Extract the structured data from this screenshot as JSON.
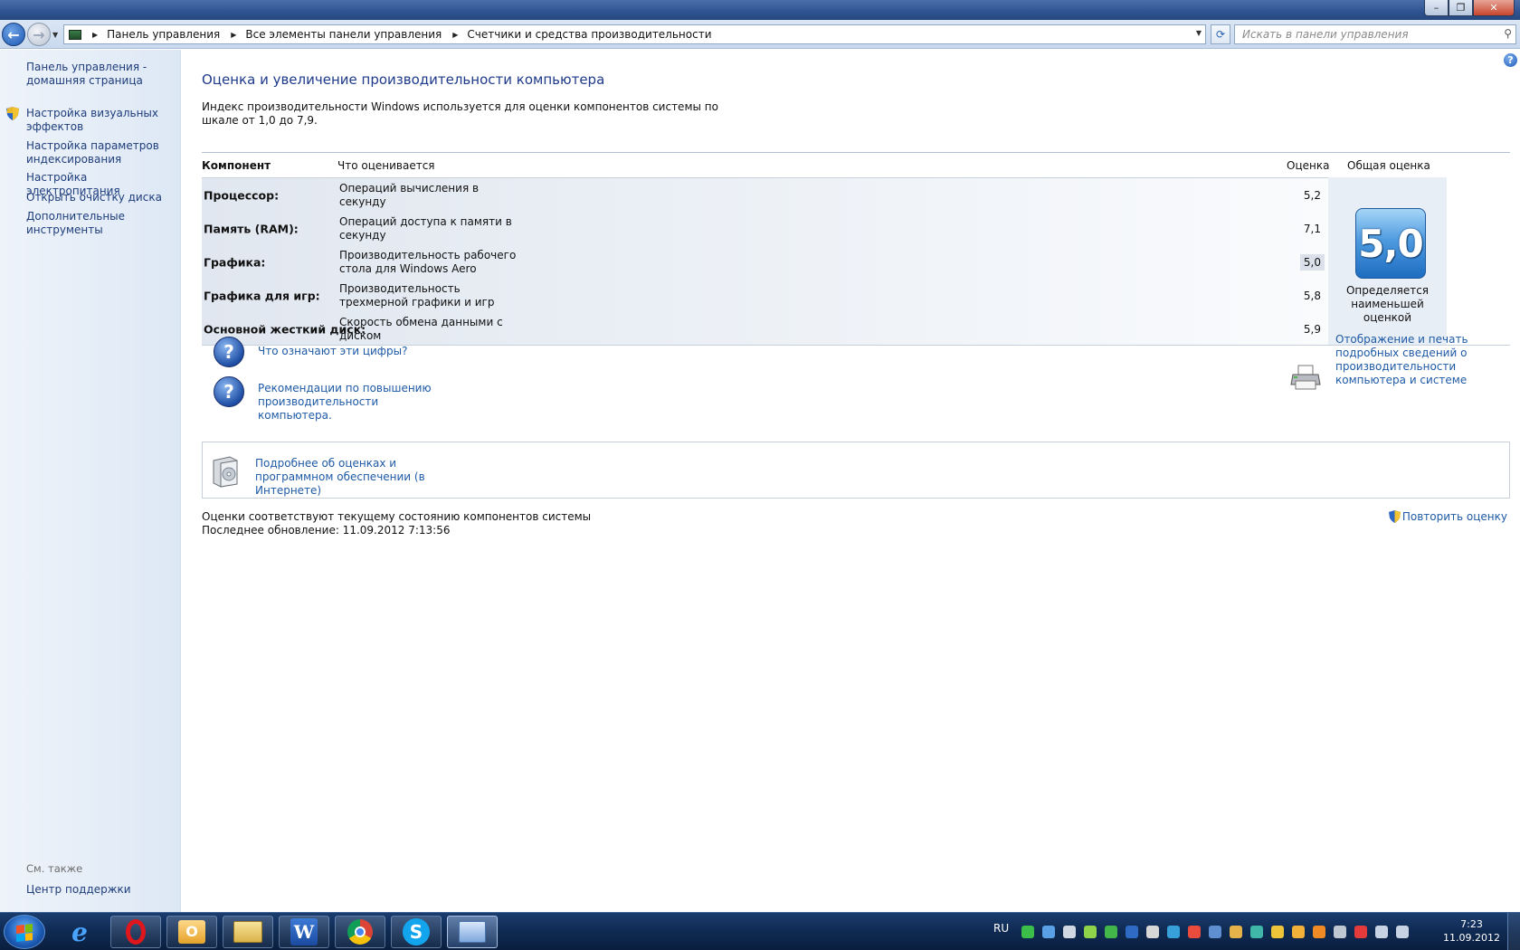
{
  "nav": {
    "breadcrumbs": [
      "Панель управления",
      "Все элементы панели управления",
      "Счетчики и средства производительности"
    ],
    "search_placeholder": "Искать в панели управления"
  },
  "sidebar": {
    "links": [
      "Панель управления - домашняя страница",
      "Настройка визуальных эффектов",
      "Настройка параметров индексирования",
      "Настройка электропитания",
      "Открыть очистку диска",
      "Дополнительные инструменты"
    ],
    "see_also_label": "См. также",
    "see_also_links": [
      "Центр поддержки"
    ]
  },
  "main": {
    "title": "Оценка и увеличение производительности компьютера",
    "intro": "Индекс производительности Windows используется для оценки компонентов системы по шкале от 1,0 до 7,9.",
    "table": {
      "headers": {
        "component": "Компонент",
        "what": "Что оценивается",
        "score": "Оценка",
        "overall": "Общая оценка"
      },
      "rows": [
        {
          "component": "Процессор:",
          "what": "Операций вычисления в секунду",
          "score": "5,2"
        },
        {
          "component": "Память (RAM):",
          "what": "Операций доступа к памяти в секунду",
          "score": "7,1"
        },
        {
          "component": "Графика:",
          "what": "Производительность рабочего стола для Windows Aero",
          "score": "5,0"
        },
        {
          "component": "Графика для игр:",
          "what": "Производительность трехмерной графики и игр",
          "score": "5,8"
        },
        {
          "component": "Основной жесткий диск:",
          "what": "Скорость обмена данными с диском",
          "score": "5,9"
        }
      ],
      "overall_score": "5,0",
      "overall_caption": "Определяется наименьшей оценкой"
    },
    "links": {
      "what_numbers_mean": "Что означают эти цифры?",
      "recommendations": "Рекомендации по повышению производительности компьютера.",
      "print_details": "Отображение и печать подробных сведений о производительности компьютера и системе",
      "more_info": "Подробнее об оценках и программном обеспечении (в Интернете)"
    },
    "status_line": "Оценки соответствуют текущему состоянию компонентов системы",
    "last_update": "Последнее обновление: 11.09.2012 7:13:56",
    "rerun": "Повторить оценку"
  },
  "taskbar": {
    "apps": [
      "internet-explorer",
      "opera",
      "outlook",
      "explorer",
      "word",
      "chrome",
      "skype",
      "control-panel"
    ],
    "language": "RU",
    "time": "7:23",
    "date": "11.09.2012"
  }
}
